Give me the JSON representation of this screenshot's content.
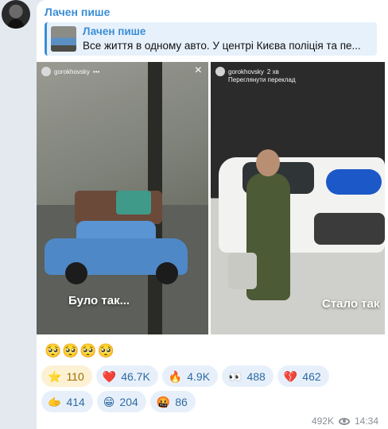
{
  "message": {
    "author": "Лачен пише",
    "reply": {
      "author": "Лачен пише",
      "text": "Все життя в одному авто. У центрі Києва поліція та пе..."
    },
    "media": {
      "left": {
        "story_user": "gorokhovsky",
        "caption": "Було так..."
      },
      "right": {
        "story_user": "gorokhovsky",
        "story_time": "2 хв",
        "story_action": "Переглянути переклад",
        "caption": "Стало так"
      }
    },
    "emoji_text": "🥺🥺🥺🥺",
    "reactions": [
      {
        "icon": "star",
        "glyph": "⭐",
        "count": "110"
      },
      {
        "icon": "heart",
        "glyph": "❤️",
        "count": "46.7K"
      },
      {
        "icon": "fire",
        "glyph": "🔥",
        "count": "4.9K"
      },
      {
        "icon": "eyes",
        "glyph": "👀",
        "count": "488"
      },
      {
        "icon": "broken-heart",
        "glyph": "💔",
        "count": "462"
      },
      {
        "icon": "pointing-hand",
        "glyph": "🫱",
        "count": "414"
      },
      {
        "icon": "grimace",
        "glyph": "😁",
        "count": "204"
      },
      {
        "icon": "angry",
        "glyph": "🤬",
        "count": "86"
      }
    ],
    "views": "492K",
    "time": "14:34"
  }
}
